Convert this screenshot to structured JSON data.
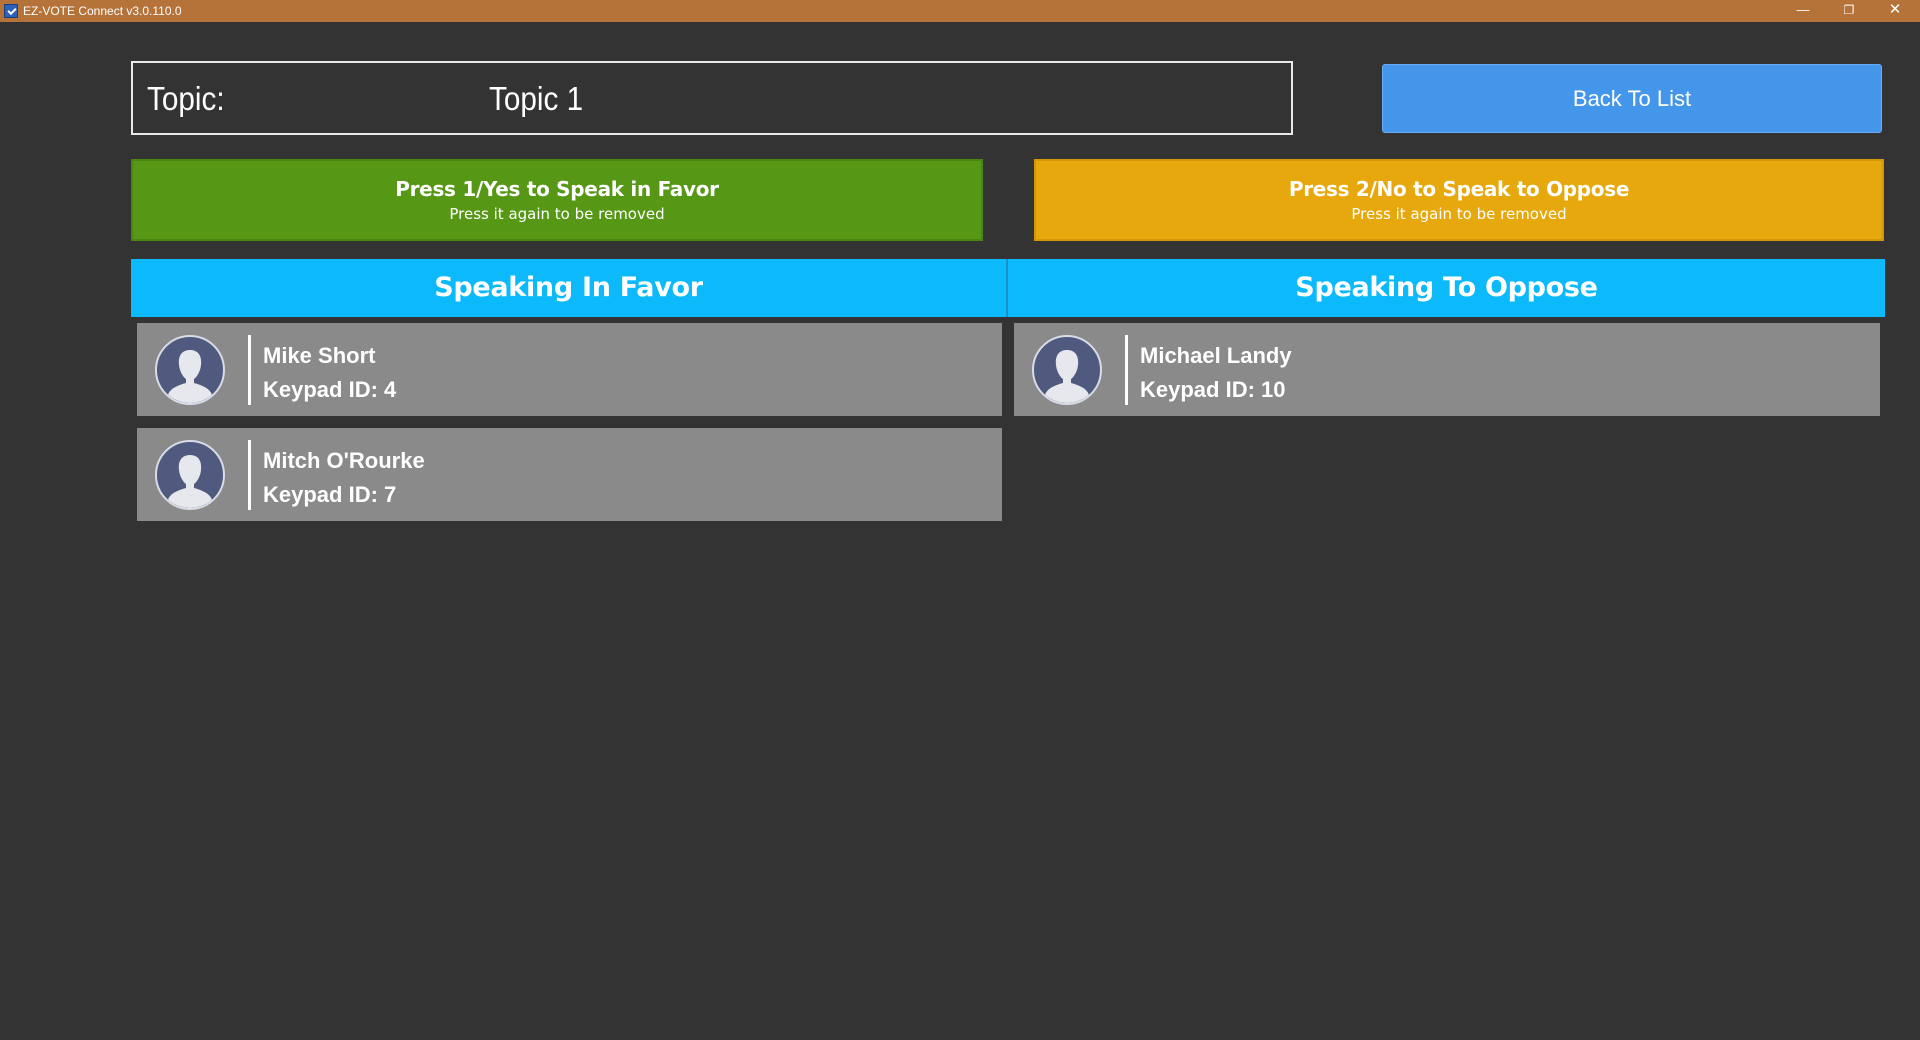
{
  "window": {
    "title": "EZ-VOTE Connect v3.0.110.0",
    "minimize_glyph": "—",
    "maximize_glyph": "❐",
    "close_glyph": "✕"
  },
  "topic": {
    "label": "Topic:",
    "value": "Topic 1"
  },
  "back_button": {
    "label": "Back To List"
  },
  "prompts": {
    "favor": {
      "title": "Press 1/Yes to Speak in Favor",
      "subtitle": "Press it again to be removed",
      "color": "#569816"
    },
    "oppose": {
      "title": "Press 2/No to Speak to Oppose",
      "subtitle": "Press it again to be removed",
      "color": "#e6a80c"
    }
  },
  "columns": {
    "favor": {
      "header": "Speaking In Favor",
      "speakers": [
        {
          "name": "Mike Short",
          "keypad": "Keypad ID: 4",
          "icon": "user-avatar-icon"
        },
        {
          "name": "Mitch O'Rourke",
          "keypad": "Keypad ID: 7",
          "icon": "user-avatar-icon"
        }
      ]
    },
    "oppose": {
      "header": "Speaking To Oppose",
      "speakers": [
        {
          "name": "Michael Landy",
          "keypad": "Keypad ID: 10",
          "icon": "user-avatar-icon"
        }
      ]
    }
  },
  "colors": {
    "titlebar": "#b5733a",
    "background": "#333333",
    "header": "#0cb9fa",
    "back_button": "#4496ea",
    "card": "#8a8a8a"
  }
}
